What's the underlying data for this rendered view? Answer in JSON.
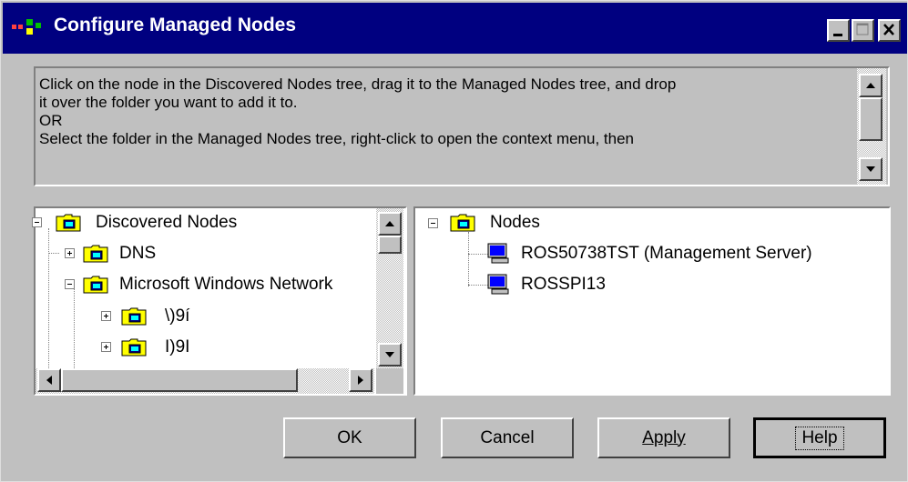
{
  "window": {
    "title": "Configure Managed Nodes"
  },
  "instructions": {
    "line1": "Click on the node in the Discovered Nodes tree, drag it to the Managed Nodes tree, and drop",
    "line2": "it over the folder you want to add it to.",
    "line3": "OR",
    "line4": "Select the folder in the Managed Nodes tree, right-click to open the context menu, then"
  },
  "discovered_tree": {
    "root": "Discovered Nodes",
    "items": [
      {
        "label": "DNS"
      },
      {
        "label": "Microsoft Windows Network"
      },
      {
        "label": "\\)9í"
      },
      {
        "label": "I)9I"
      }
    ]
  },
  "managed_tree": {
    "root": "Nodes",
    "items": [
      {
        "label": "ROS50738TST (Management Server)"
      },
      {
        "label": "ROSSPI13"
      }
    ]
  },
  "buttons": {
    "ok": "OK",
    "cancel": "Cancel",
    "apply": "Apply",
    "help": "Help"
  },
  "colors": {
    "titlebar": "#000080",
    "face": "#c0c0c0",
    "folder": "#ffff00"
  }
}
